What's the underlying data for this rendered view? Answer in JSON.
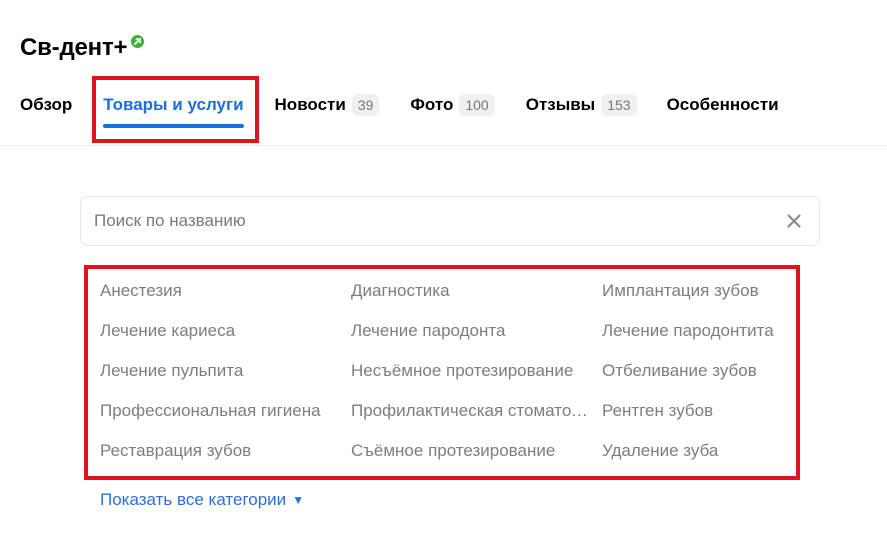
{
  "header": {
    "title": "Св-дент+",
    "verified_icon": "verified-badge-icon",
    "verified_color": "#3db236"
  },
  "tabs": [
    {
      "label": "Обзор",
      "count": null,
      "active": false
    },
    {
      "label": "Товары и услуги",
      "count": null,
      "active": true
    },
    {
      "label": "Новости",
      "count": "39",
      "active": false
    },
    {
      "label": "Фото",
      "count": "100",
      "active": false
    },
    {
      "label": "Отзывы",
      "count": "153",
      "active": false
    },
    {
      "label": "Особенности",
      "count": null,
      "active": false
    }
  ],
  "search": {
    "placeholder": "Поиск по названию",
    "clear_icon": "close-icon"
  },
  "categories": [
    "Анестезия",
    "Диагностика",
    "Имплантация зубов",
    "Лечение кариеса",
    "Лечение пародонта",
    "Лечение пародонтита",
    "Лечение пульпита",
    "Несъёмное протезирование",
    "Отбеливание зубов",
    "Профессиональная гигиена",
    "Профилактическая стоматология",
    "Рентген зубов",
    "Реставрация зубов",
    "Съёмное протезирование",
    "Удаление зуба"
  ],
  "show_all": {
    "label": "Показать все категории",
    "icon": "triangle-down-icon"
  },
  "colors": {
    "accent": "#1a6ee0",
    "highlight": "#e0141c",
    "link": "#2d6fd7"
  }
}
